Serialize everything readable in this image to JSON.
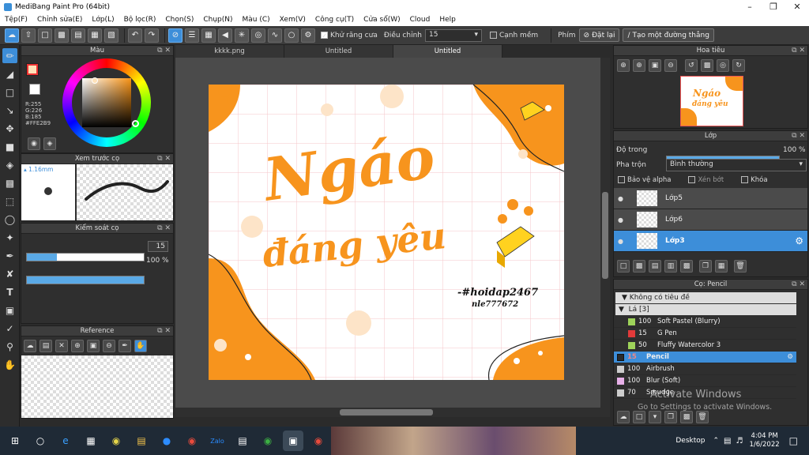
{
  "window": {
    "title": "MediBang Paint Pro (64bit)"
  },
  "menu": [
    "Tệp(F)",
    "Chỉnh sửa(E)",
    "Lớp(L)",
    "Bộ lọc(R)",
    "Chọn(S)",
    "Chụp(N)",
    "Màu (C)",
    "Xem(V)",
    "Công cụ(T)",
    "Cửa sổ(W)",
    "Cloud",
    "Help"
  ],
  "toolbar": {
    "antialias": "Khử răng cưa",
    "correction_label": "Điều chỉnh",
    "correction_value": "15",
    "sharp_edges": "Cạnh mềm",
    "key_label": "Phím",
    "reset_label": "Đặt lại",
    "new_line_label": "Tạo một đường thẳng"
  },
  "color_panel": {
    "title": "Màu",
    "r": "R:255",
    "g": "G:226",
    "b": "B:185",
    "hex": "#FFE2B9",
    "primary": "#FFE2B9"
  },
  "preview_panel": {
    "title": "Xem trước cọ",
    "size": "1.16mm"
  },
  "brush_control": {
    "title": "Kiểm soát cọ",
    "size_value": "15",
    "opacity_value": "100 %",
    "size_fraction": 0.26,
    "opacity_fraction": 1.0
  },
  "reference_panel": {
    "title": "Reference"
  },
  "tabs": [
    {
      "label": "kkkk.png"
    },
    {
      "label": "Untitled"
    },
    {
      "label": "Untitled"
    }
  ],
  "artwork": {
    "line1": "Ngáo",
    "line2": "đáng yêu",
    "handle": "-#hoidap2467",
    "handle2": "nle777672",
    "accent": "#F7941D"
  },
  "navigator": {
    "title": "Hoa tiêu",
    "thumb_line1": "Ngáo",
    "thumb_line2": "đáng yêu"
  },
  "layer_panel": {
    "title": "Lớp",
    "opacity_label": "Độ trong",
    "opacity_value": "100 %",
    "opacity_fraction": 1.0,
    "blend_label": "Pha trộn",
    "blend_value": "Bình thường",
    "protect_alpha": "Bảo vệ alpha",
    "clipping": "Xén bớt",
    "lock": "Khóa",
    "layers": [
      {
        "name": "Lớp5"
      },
      {
        "name": "Lớp6"
      },
      {
        "name": "Lớp3"
      }
    ]
  },
  "brush_panel": {
    "title": "Cọ: Pencil",
    "group": "Không có tiêu đề",
    "folder": "Lá [3]",
    "items": [
      {
        "size": "100",
        "name": "Soft Pastel (Blurry)",
        "color": "#9ED35A"
      },
      {
        "size": "15",
        "name": "G Pen",
        "color": "#E23A3A"
      },
      {
        "size": "50",
        "name": "Fluffy Watercolor 3",
        "color": "#9ED35A"
      },
      {
        "size": "15",
        "name": "Pencil",
        "color": "#2a2a2a"
      },
      {
        "size": "100",
        "name": "Airbrush",
        "color": "#cccccc"
      },
      {
        "size": "100",
        "name": "Blur (Soft)",
        "color": "#E7B0E8"
      },
      {
        "size": "70",
        "name": "Smudge",
        "color": "#cccccc"
      }
    ]
  },
  "watermark": {
    "line1": "Activate Windows",
    "line2": "Go to Settings to activate Windows."
  },
  "taskbar": {
    "desktop": "Desktop",
    "time": "4:04 PM",
    "date": "1/6/2022"
  }
}
